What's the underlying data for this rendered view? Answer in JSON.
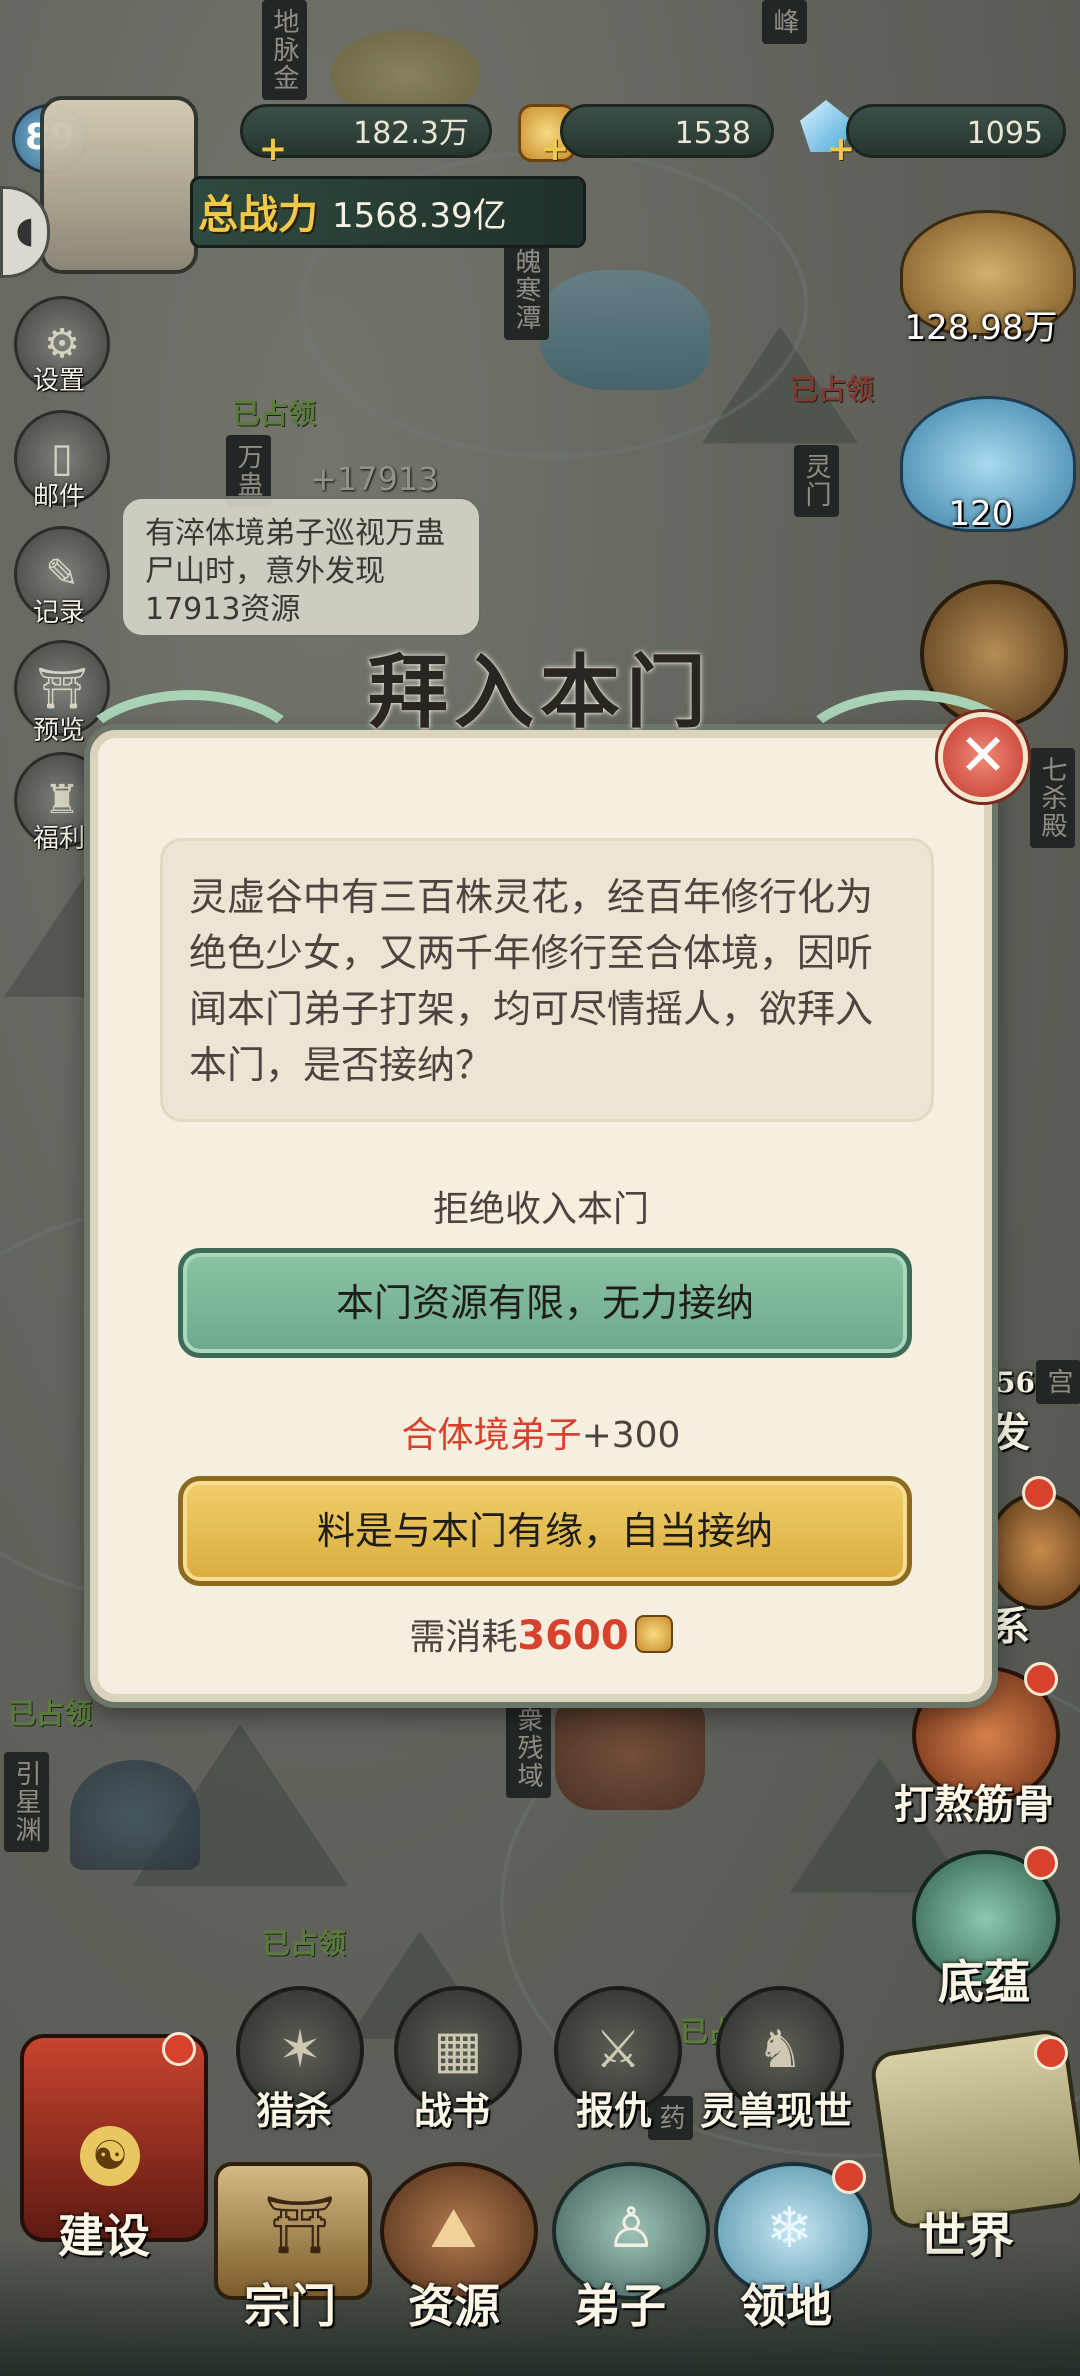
{
  "top_bar": {
    "level": "89",
    "power_label": "总战力",
    "power_value": "1568.39亿",
    "resources": [
      {
        "name": "silver",
        "value": "182.3万"
      },
      {
        "name": "gold",
        "value": "1538"
      },
      {
        "name": "crystal",
        "value": "1095"
      }
    ]
  },
  "side_menu": [
    {
      "label": "设置",
      "icon": "gear-icon"
    },
    {
      "label": "邮件",
      "icon": "mail-icon"
    },
    {
      "label": "记录",
      "icon": "record-icon"
    },
    {
      "label": "预览",
      "icon": "preview-icon"
    },
    {
      "label": "福利",
      "icon": "gift-icon"
    }
  ],
  "right_resources": [
    {
      "value": "128.98万"
    },
    {
      "value": "120"
    }
  ],
  "notification": {
    "text": "有淬体境弟子巡视万蛊尸山时，意外发现17913资源",
    "float_gain": "+17913"
  },
  "map_labels": {
    "label_1": "地脉金",
    "label_2": "峰",
    "label_3": "魄寒潭",
    "label_4": "万蛊",
    "label_5": "灵门",
    "label_6": "七杀殿",
    "label_7": "宫",
    "label_8": "引星渊",
    "label_9": "衆残域",
    "label_10": "药",
    "seal_text": "已占领"
  },
  "dialog": {
    "title": "拜入本门",
    "description": "灵虚谷中有三百株灵花，经百年修行化为绝色少女，又两千年修行至合体境，因听闻本门弟子打架，均可尽情摇人，欲拜入本门，是否接纳？",
    "refuse_hint": "拒绝收入本门",
    "refuse_button": "本门资源有限，无力接纳",
    "reward_name": "合体境弟子",
    "reward_amount": "+300",
    "accept_button": "料是与本门有缘，自当接纳",
    "cost_label": "需消耗",
    "cost_value": "3600"
  },
  "right_menu": [
    {
      "label": "打熬筋骨"
    },
    {
      "label": "底蕴"
    },
    {
      "label": "世界"
    }
  ],
  "right_partial": [
    {
      "label": "发"
    },
    {
      "label": "系"
    },
    {
      "label": "56"
    }
  ],
  "action_row": [
    {
      "label": "猎杀",
      "icon": "hunt-icon"
    },
    {
      "label": "战书",
      "icon": "war-letter-icon"
    },
    {
      "label": "报仇",
      "icon": "revenge-icon"
    },
    {
      "label": "灵兽现世",
      "icon": "beast-icon"
    }
  ],
  "bottom_nav": [
    {
      "label": "建设",
      "icon": "build-icon"
    },
    {
      "label": "宗门",
      "icon": "sect-icon"
    },
    {
      "label": "资源",
      "icon": "resource-icon"
    },
    {
      "label": "弟子",
      "icon": "disciple-icon"
    },
    {
      "label": "领地",
      "icon": "territory-icon"
    }
  ],
  "colors": {
    "dialog_bg": "#f5efdf",
    "refuse_green": "#7ab597",
    "accept_gold": "#e6bd52",
    "reward_red": "#d8412c"
  }
}
